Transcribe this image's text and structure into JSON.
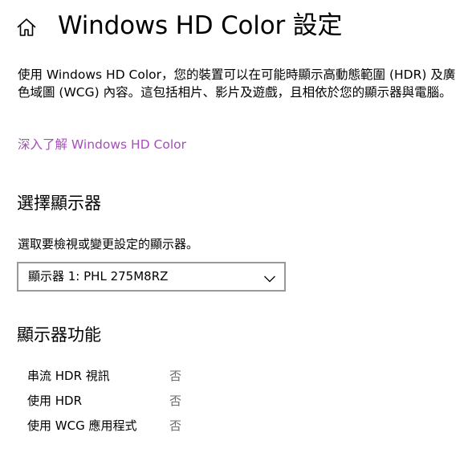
{
  "header": {
    "title": "Windows HD Color 設定"
  },
  "description": "使用 Windows HD Color，您的裝置可以在可能時顯示高動態範圍 (HDR) 及廣色域圖 (WCG) 內容。這包括相片、影片及遊戲，且相依於您的顯示器與電腦。",
  "learn_more_link": "深入了解 Windows HD Color",
  "select_display": {
    "heading": "選擇顯示器",
    "description": "選取要檢視或變更設定的顯示器。",
    "dropdown_value": "顯示器 1: PHL 275M8RZ"
  },
  "display_capabilities": {
    "heading": "顯示器功能",
    "rows": [
      {
        "label": "串流 HDR 視訊",
        "value": "否"
      },
      {
        "label": "使用 HDR",
        "value": "否"
      },
      {
        "label": "使用 WCG 應用程式",
        "value": "否"
      }
    ]
  },
  "colors": {
    "link": "#a64dbb",
    "dropdown_border": "#999999",
    "value_text": "#6b6b6b"
  },
  "icons": {
    "home": "home-icon",
    "dropdown": "chevron-down-icon"
  }
}
